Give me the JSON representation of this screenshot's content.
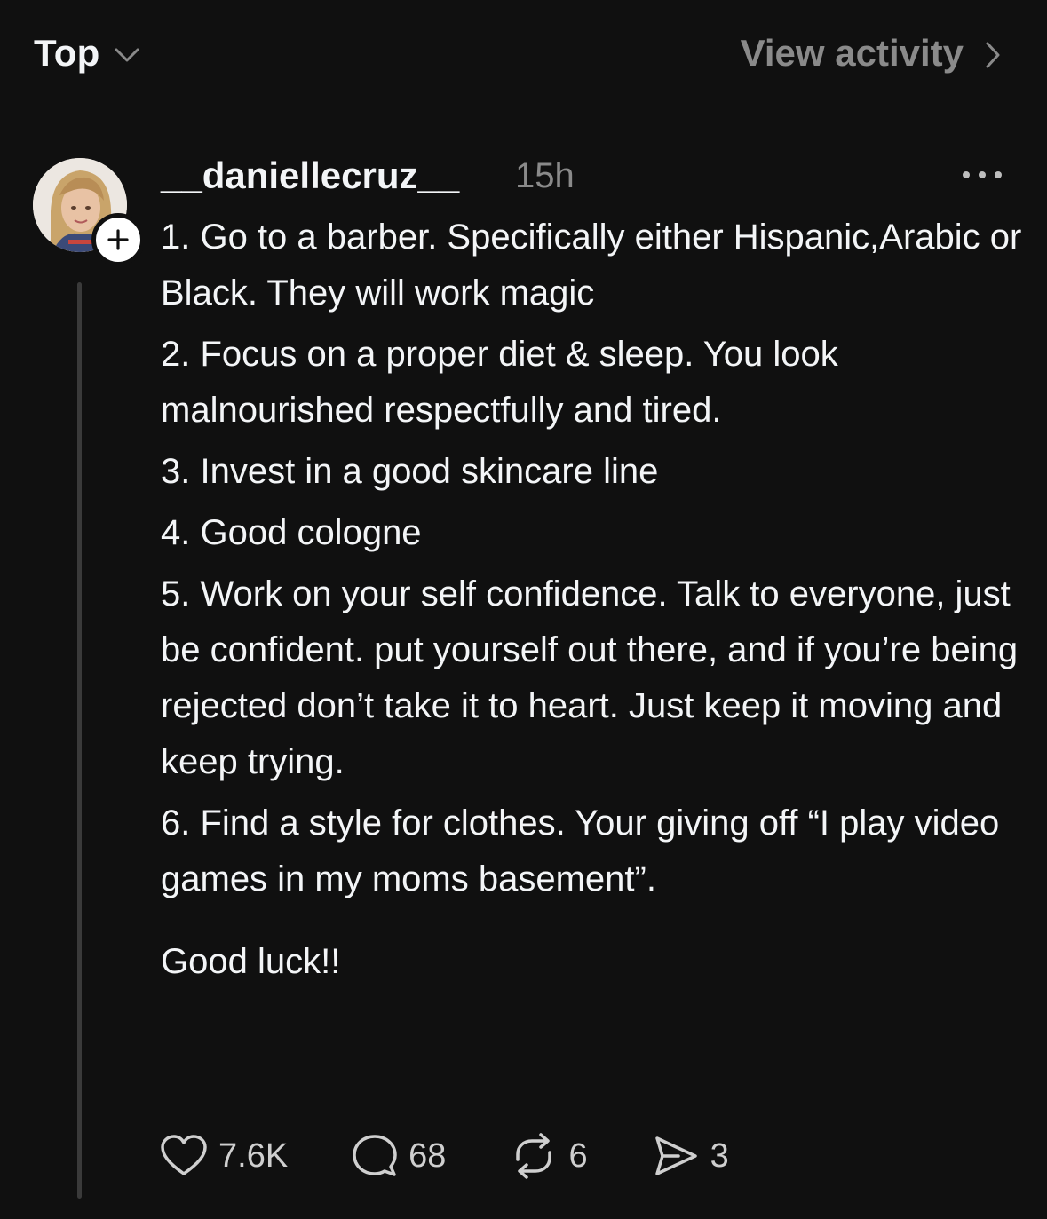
{
  "header": {
    "sort_label": "Top",
    "view_activity_label": "View activity"
  },
  "post": {
    "username": "__daniellecruz__",
    "timestamp": "15h",
    "body": [
      "1. Go to a barber. Specifically either Hispanic,Arabic or Black. They will work magic",
      "2. Focus on a proper diet & sleep. You look malnourished respectfully and tired.",
      "3. Invest in a good skincare line",
      "4. Good cologne",
      "5. Work on your self confidence. Talk to everyone, just be confident. put yourself out there, and if you’re being rejected don’t take it to heart. Just keep it moving and keep trying.",
      "6. Find a style for clothes. Your giving off “I play video games in my moms basement”."
    ],
    "signoff": "Good luck!!",
    "actions": {
      "likes": "7.6K",
      "replies": "68",
      "reposts": "6",
      "shares": "3"
    }
  },
  "colors": {
    "background": "#101010",
    "text_primary": "#f3f5f7",
    "text_secondary": "#8a8a8a",
    "thread_line": "#3a3a3a"
  },
  "icons": {
    "sort": "chevron-down-icon",
    "view_activity": "chevron-right-icon",
    "follow": "plus-icon",
    "more": "ellipsis-icon",
    "like": "heart-icon",
    "reply": "comment-icon",
    "repost": "repost-icon",
    "share": "send-icon"
  }
}
